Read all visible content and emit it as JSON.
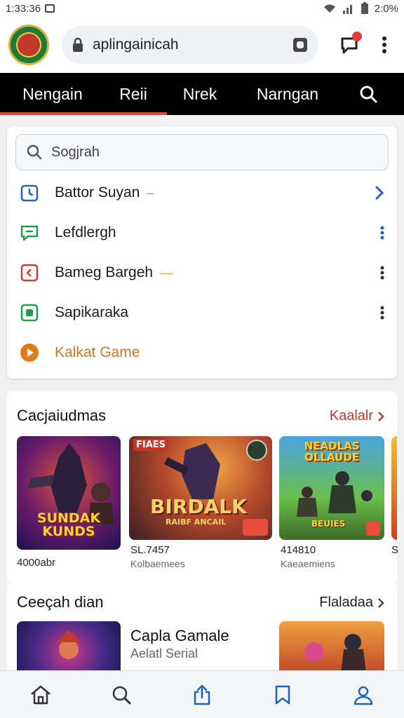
{
  "status": {
    "time": "1:33:36",
    "battery": "2:0%"
  },
  "address": {
    "url": "aplingainicah"
  },
  "tabs": [
    "Nengain",
    "Reii",
    "Nrek",
    "Narngan"
  ],
  "search": {
    "placeholder": "Sogjrah"
  },
  "menu": [
    {
      "label": "Battor Suyan",
      "icon": "calendar-icon",
      "color": "#1e63c4",
      "trail": "chevron-right-icon"
    },
    {
      "label": "Lefdlergh",
      "icon": "chat-icon",
      "color": "#1e9e4a",
      "trail": "more-vert-icon"
    },
    {
      "label": "Bameg Bargeh",
      "icon": "clipboard-icon",
      "color": "#d63a2f",
      "trail": "more-vert-icon"
    },
    {
      "label": "Sapikaraka",
      "icon": "app-icon",
      "color": "#1e9e4a",
      "trail": "more-vert-icon"
    },
    {
      "label": "Kalkat Game",
      "icon": "play-icon",
      "color": "#e07b1a",
      "trail": ""
    }
  ],
  "section1": {
    "title": "Cacjaiudmas",
    "link": "Kaalalr",
    "games": [
      {
        "art_text": "SUNDAK KUNDS",
        "caption": "4000abr",
        "sub": ""
      },
      {
        "art_text": "BIRDALK",
        "art_sub": "RAIBF ANCAIL",
        "badge": "FIAES",
        "caption": "SL.7457",
        "sub": "Kolbaemees"
      },
      {
        "art_text": "NEADLAS OLLAUDE",
        "art_sub": "BEUIES",
        "caption": "414810",
        "sub": "Kaeaemiens"
      }
    ],
    "extra_caption": "S"
  },
  "section2": {
    "title": "Ceeçah dian",
    "link": "Flaladaa",
    "featured_title": "Capla Gamale",
    "featured_sub": "Aelatl Serial"
  },
  "bottom": [
    "home-icon",
    "search-icon",
    "share-icon",
    "bookmark-icon",
    "profile-icon"
  ],
  "colors": {
    "accent": "#e0442b",
    "link": "#c0392b",
    "nav_bg": "#000000"
  }
}
